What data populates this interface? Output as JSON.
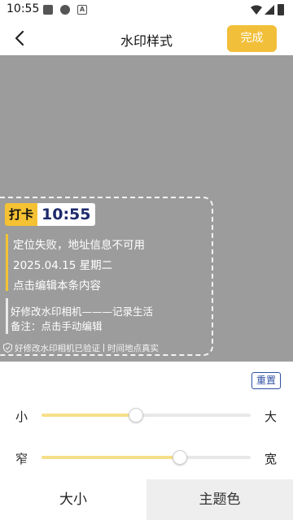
{
  "status_bar": {
    "time": "10:55",
    "notification_icons": [
      "gallery-icon",
      "chat-icon",
      "font-icon"
    ],
    "system_icons": [
      "wifi-icon",
      "signal-icon",
      "battery-icon"
    ]
  },
  "header": {
    "title": "水印样式",
    "done_label": "完成",
    "accent_color": "#f2bf3a"
  },
  "watermark": {
    "badge_label": "打卡",
    "badge_time": "10:55",
    "lines": [
      "定位失败，地址信息不可用",
      "2025.04.15 星期二",
      "点击编辑本条内容"
    ],
    "sub_lines": [
      "好修改水印相机———记录生活",
      "备注：点击手动编辑"
    ],
    "footer_verified": "好修改水印相机已验证",
    "footer_note": "时间地点真实"
  },
  "panel": {
    "reset_label": "重置",
    "size_slider": {
      "min_label": "小",
      "max_label": "大",
      "value": 0.45
    },
    "width_slider": {
      "min_label": "窄",
      "max_label": "宽",
      "value": 0.66
    }
  },
  "tabs": [
    {
      "label": "大小",
      "active": true
    },
    {
      "label": "主题色",
      "active": false
    }
  ]
}
